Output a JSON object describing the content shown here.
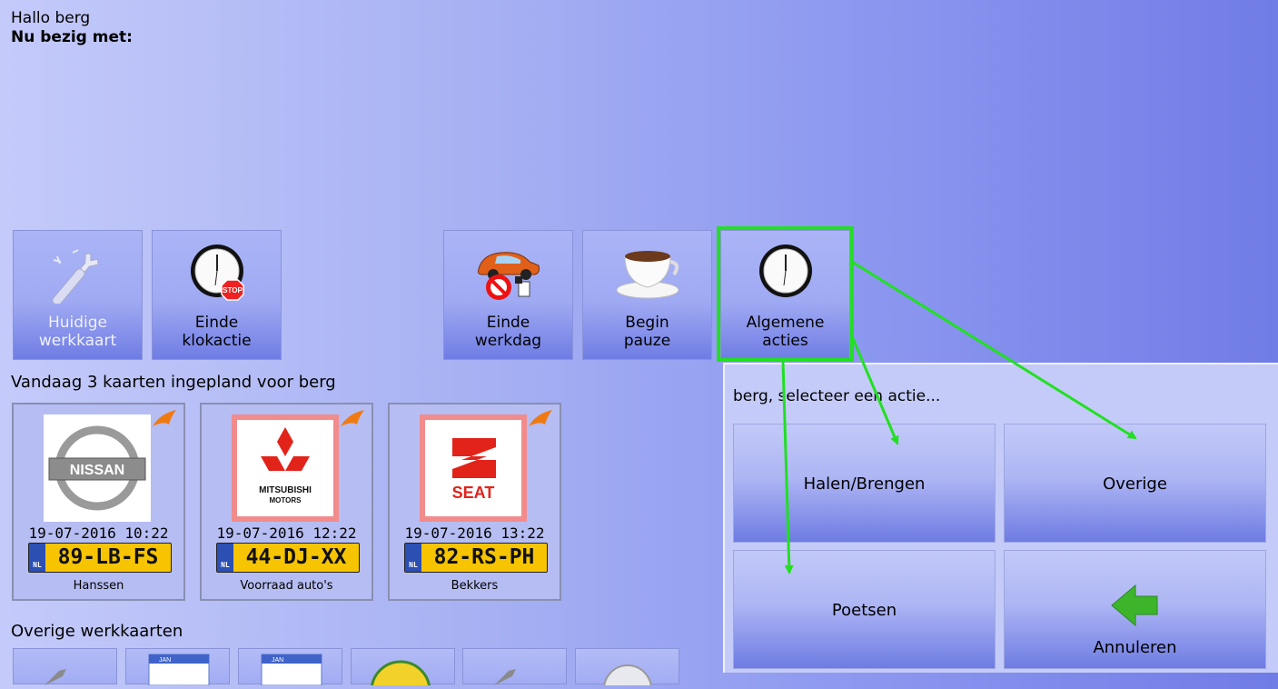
{
  "header": {
    "greeting": "Hallo berg",
    "busy_label": "Nu bezig met:"
  },
  "toolbar": {
    "current_card": {
      "line1": "Huidige",
      "line2": "werkkaart"
    },
    "end_clock": {
      "line1": "Einde",
      "line2": "klokactie"
    },
    "end_day": {
      "line1": "Einde",
      "line2": "werkdag"
    },
    "begin_break": {
      "line1": "Begin",
      "line2": "pauze"
    },
    "general_actions": {
      "line1": "Algemene",
      "line2": "acties"
    }
  },
  "schedule": {
    "title": "Vandaag 3 kaarten ingepland voor berg",
    "cards": [
      {
        "brand": "NISSAN",
        "datetime": "19-07-2016 10:22",
        "plate": "89-LB-FS",
        "owner": "Hanssen"
      },
      {
        "brand": "MITSUBISHI",
        "brand_sub": "MOTORS",
        "datetime": "19-07-2016 12:22",
        "plate": "44-DJ-XX",
        "owner": "Voorraad auto's"
      },
      {
        "brand": "SEAT",
        "datetime": "19-07-2016 13:22",
        "plate": "82-RS-PH",
        "owner": "Bekkers"
      }
    ],
    "plate_country": "NL"
  },
  "other_cards": {
    "title": "Overige werkkaarten",
    "calendar_month": "JAN"
  },
  "action_panel": {
    "prompt": "berg, selecteer een actie...",
    "buttons": {
      "fetch_bring": "Halen/Brengen",
      "other": "Overige",
      "clean": "Poetsen",
      "cancel": "Annuleren"
    }
  },
  "colors": {
    "highlight": "#21e021",
    "plate_yellow": "#f6c400",
    "plate_blue": "#2b4fb3"
  },
  "icons": {
    "current_card": "wrench-icon",
    "end_clock": "clock-stop-icon",
    "end_day": "car-no-entry-icon",
    "begin_break": "coffee-cup-icon",
    "general_actions": "clock-icon",
    "cancel": "green-back-arrow-icon"
  }
}
